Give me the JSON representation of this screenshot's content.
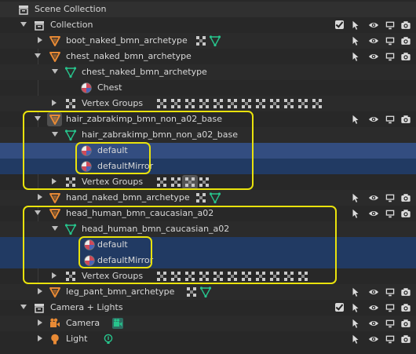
{
  "outliner": {
    "scene_collection": "Scene Collection",
    "collection": "Collection",
    "boot_obj": "boot_naked_bmn_archetype",
    "chest_obj": "chest_naked_bmn_archetype",
    "chest_mesh": "chest_naked_bmn_archetype",
    "chest_mat": "Chest",
    "vertex_groups": "Vertex Groups",
    "hair_obj": "hair_zabrakimp_bmn_non_a02_base",
    "hair_mesh": "hair_zabrakimp_bmn_non_a02_base",
    "hair_mat_1": "default",
    "hair_mat_2": "defaultMirror",
    "hand_obj": "hand_naked_bmn_archetype",
    "head_obj": "head_human_bmn_caucasian_a02",
    "head_mesh": "head_human_bmn_caucasian_a02",
    "head_mat_1": "default",
    "head_mat_2": "defaultMirror",
    "leg_obj": "leg_pant_bmn_archetype",
    "camlights": "Camera + Lights",
    "camera": "Camera",
    "light": "Light"
  },
  "colors": {
    "highlight": "#e9e20c",
    "selection": "#334d80",
    "object_orange": "#e88a35",
    "mesh_green": "#27c48c"
  }
}
